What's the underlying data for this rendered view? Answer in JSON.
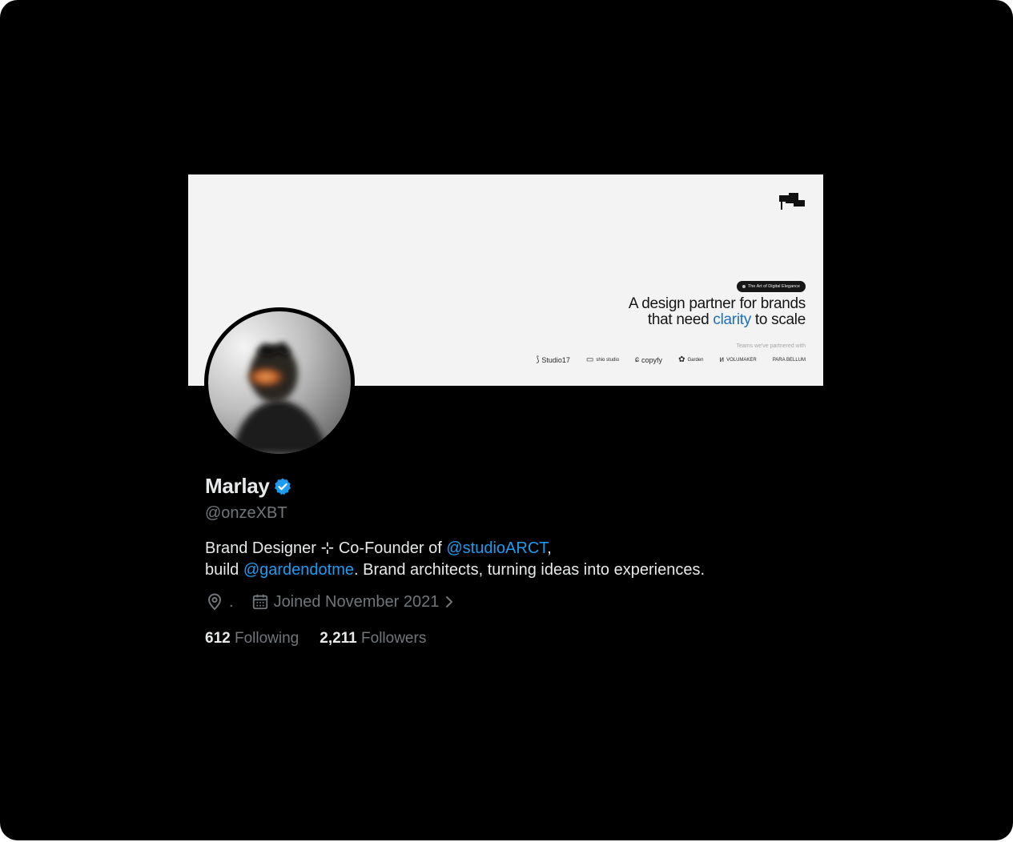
{
  "banner": {
    "tag": "The Art of Digital Elegance",
    "headline_line1": "A design partner for brands",
    "headline_line2_pre": "that need ",
    "headline_line2_highlight": "clarity",
    "headline_line2_post": " to scale",
    "partners_label": "Teams we've partnered with",
    "partners": [
      "Studio17",
      "shio studio",
      "copyfy",
      "Garden",
      "VOLUMAKER",
      "PARA BELLUM"
    ]
  },
  "profile": {
    "name": "Marlay",
    "handle": "@onzeXBT",
    "bio_line1_pre": "Brand Designer ⊹ Co-Founder of ",
    "bio_line1_mention": "@studioARCT",
    "bio_line1_post": ",",
    "bio_line2_pre": "build ",
    "bio_line2_mention": "@gardendotme",
    "bio_line2_post": ". Brand architects, turning ideas into experiences.",
    "location": ".",
    "joined": "Joined November 2021",
    "following_count": "612",
    "following_label": "Following",
    "followers_count": "2,211",
    "followers_label": "Followers"
  },
  "icons": {
    "verified": "verified-badge-icon",
    "location": "location-pin-icon",
    "calendar": "calendar-icon",
    "chevron": "chevron-right-icon"
  },
  "colors": {
    "background": "#000000",
    "accent": "#1d9bf0",
    "secondary_text": "#71767b",
    "primary_text": "#e7e9ea"
  }
}
